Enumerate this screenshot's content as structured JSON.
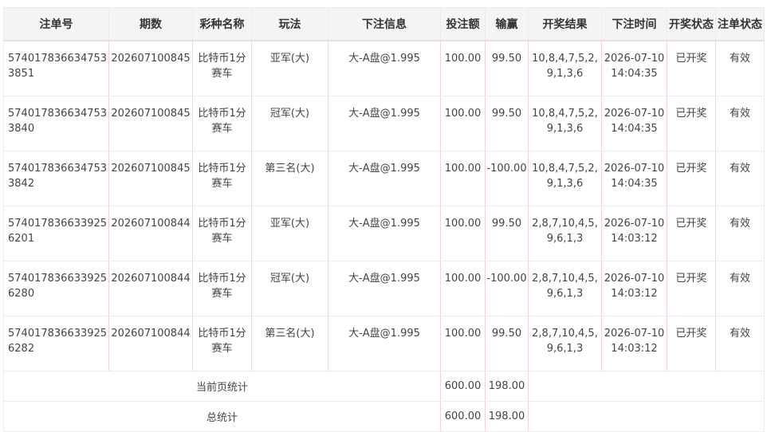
{
  "table": {
    "headers": [
      "注单号",
      "期数",
      "彩种名称",
      "玩法",
      "下注信息",
      "投注额",
      "输赢",
      "开奖结果",
      "下注时间",
      "开奖状态",
      "注单状态"
    ],
    "rows": [
      {
        "bet_id": "5740178366347533851",
        "period": "202607100845",
        "lottery": "比特币1分赛车",
        "play": "亚军(大)",
        "info": "大-A盘@1.995",
        "amount": "100.00",
        "win_loss": "99.50",
        "result": "10,8,4,7,5,2,9,1,3,6",
        "time_date": "2026-07-10",
        "time_clock": "14:04:35",
        "draw_status": "已开奖",
        "bet_status": "有效"
      },
      {
        "bet_id": "5740178366347533840",
        "period": "202607100845",
        "lottery": "比特币1分赛车",
        "play": "冠军(大)",
        "info": "大-A盘@1.995",
        "amount": "100.00",
        "win_loss": "99.50",
        "result": "10,8,4,7,5,2,9,1,3,6",
        "time_date": "2026-07-10",
        "time_clock": "14:04:35",
        "draw_status": "已开奖",
        "bet_status": "有效"
      },
      {
        "bet_id": "5740178366347533842",
        "period": "202607100845",
        "lottery": "比特币1分赛车",
        "play": "第三名(大)",
        "info": "大-A盘@1.995",
        "amount": "100.00",
        "win_loss": "-100.00",
        "result": "10,8,4,7,5,2,9,1,3,6",
        "time_date": "2026-07-10",
        "time_clock": "14:04:35",
        "draw_status": "已开奖",
        "bet_status": "有效"
      },
      {
        "bet_id": "5740178366339256201",
        "period": "202607100844",
        "lottery": "比特币1分赛车",
        "play": "亚军(大)",
        "info": "大-A盘@1.995",
        "amount": "100.00",
        "win_loss": "99.50",
        "result": "2,8,7,10,4,5,9,6,1,3",
        "time_date": "2026-07-10",
        "time_clock": "14:03:12",
        "draw_status": "已开奖",
        "bet_status": "有效"
      },
      {
        "bet_id": "5740178366339256280",
        "period": "202607100844",
        "lottery": "比特币1分赛车",
        "play": "冠军(大)",
        "info": "大-A盘@1.995",
        "amount": "100.00",
        "win_loss": "-100.00",
        "result": "2,8,7,10,4,5,9,6,1,3",
        "time_date": "2026-07-10",
        "time_clock": "14:03:12",
        "draw_status": "已开奖",
        "bet_status": "有效"
      },
      {
        "bet_id": "5740178366339256282",
        "period": "202607100844",
        "lottery": "比特币1分赛车",
        "play": "第三名(大)",
        "info": "大-A盘@1.995",
        "amount": "100.00",
        "win_loss": "99.50",
        "result": "2,8,7,10,4,5,9,6,1,3",
        "time_date": "2026-07-10",
        "time_clock": "14:03:12",
        "draw_status": "已开奖",
        "bet_status": "有效"
      }
    ]
  },
  "summary": {
    "page_label": "当前页统计",
    "page_amount": "600.00",
    "page_win_loss": "198.00",
    "total_label": "总统计",
    "total_amount": "600.00",
    "total_win_loss": "198.00"
  }
}
